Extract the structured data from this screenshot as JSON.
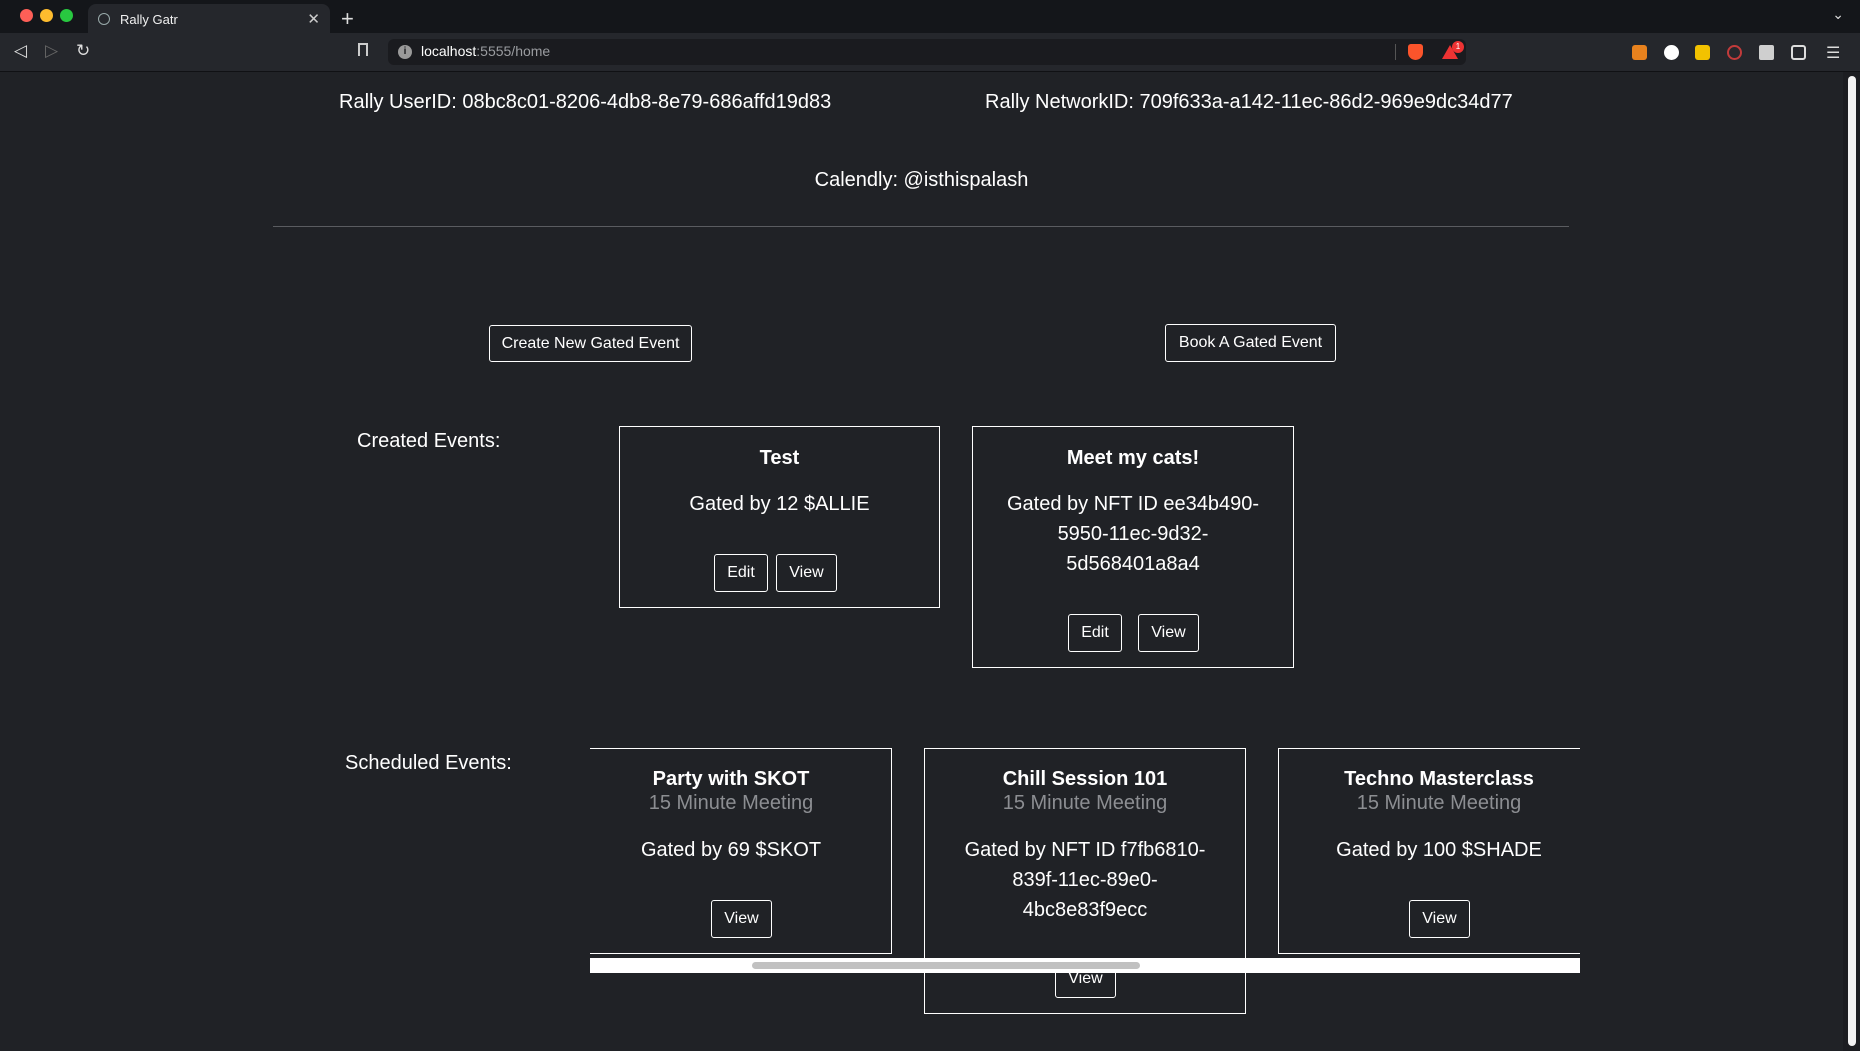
{
  "browser": {
    "tab_title": "Rally Gatr",
    "url_host": "localhost",
    "url_path": ":5555/home",
    "rewards_badge": "1",
    "traffic_colors": [
      "#fe5f57",
      "#febc2e",
      "#28c840"
    ]
  },
  "profile": {
    "user_id": "Rally UserID: 08bc8c01-8206-4db8-8e79-686affd19d83",
    "network_id": "Rally NetworkID: 709f633a-a142-11ec-86d2-969e9dc34d77",
    "calendly": "Calendly: @isthispalash"
  },
  "actions": {
    "create_label": "Create New Gated Event",
    "book_label": "Book A Gated Event"
  },
  "created": {
    "label": "Created Events:",
    "events": [
      {
        "title": "Test",
        "gate": "Gated by 12 $ALLIE",
        "edit_label": "Edit",
        "view_label": "View"
      },
      {
        "title": "Meet my cats!",
        "gate": "Gated by NFT ID ee34b490-5950-11ec-9d32-5d568401a8a4",
        "edit_label": "Edit",
        "view_label": "View"
      }
    ]
  },
  "scheduled": {
    "label": "Scheduled Events:",
    "events": [
      {
        "title": "Party with SKOT",
        "subtitle": "15 Minute Meeting",
        "gate": "Gated by 69 $SKOT",
        "view_label": "View"
      },
      {
        "title": "Chill Session 101",
        "subtitle": "15 Minute Meeting",
        "gate": "Gated by NFT ID f7fb6810-839f-11ec-89e0-4bc8e83f9ecc",
        "view_label": "View"
      },
      {
        "title": "Techno Masterclass",
        "subtitle": "15 Minute Meeting",
        "gate": "Gated by 100 $SHADE",
        "view_label": "View"
      }
    ]
  }
}
